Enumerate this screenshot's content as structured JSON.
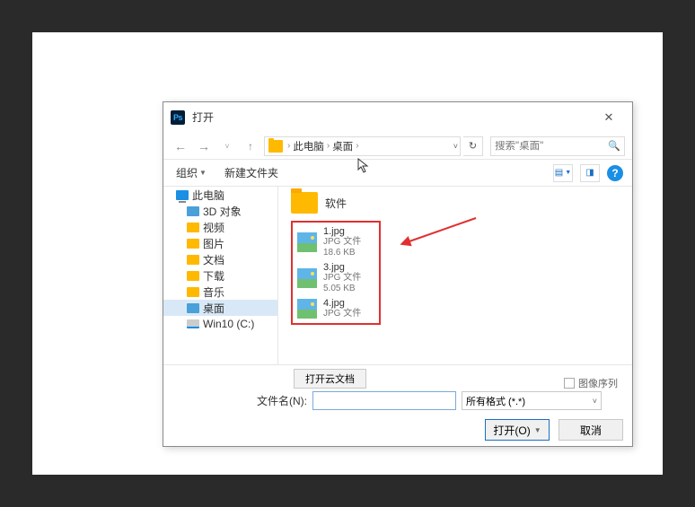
{
  "dialog": {
    "title": "打开",
    "breadcrumb": {
      "loc1": "此电脑",
      "loc2": "桌面"
    },
    "search_placeholder": "搜索\"桌面\"",
    "organize": "组织",
    "new_folder": "新建文件夹",
    "cloud_doc": "打开云文档",
    "image_sequence": "图像序列",
    "filename_label": "文件名(N):",
    "format": "所有格式 (*.*)",
    "open_btn": "打开(O)",
    "cancel_btn": "取消"
  },
  "sidebar": [
    "此电脑",
    "3D 对象",
    "视频",
    "图片",
    "文档",
    "下载",
    "音乐",
    "桌面",
    "Win10 (C:)"
  ],
  "folder": "软件",
  "files": [
    {
      "name": "1.jpg",
      "type": "JPG 文件",
      "size": "18.6 KB"
    },
    {
      "name": "3.jpg",
      "type": "JPG 文件",
      "size": "5.05 KB"
    },
    {
      "name": "4.jpg",
      "type": "JPG 文件",
      "size": ""
    }
  ]
}
